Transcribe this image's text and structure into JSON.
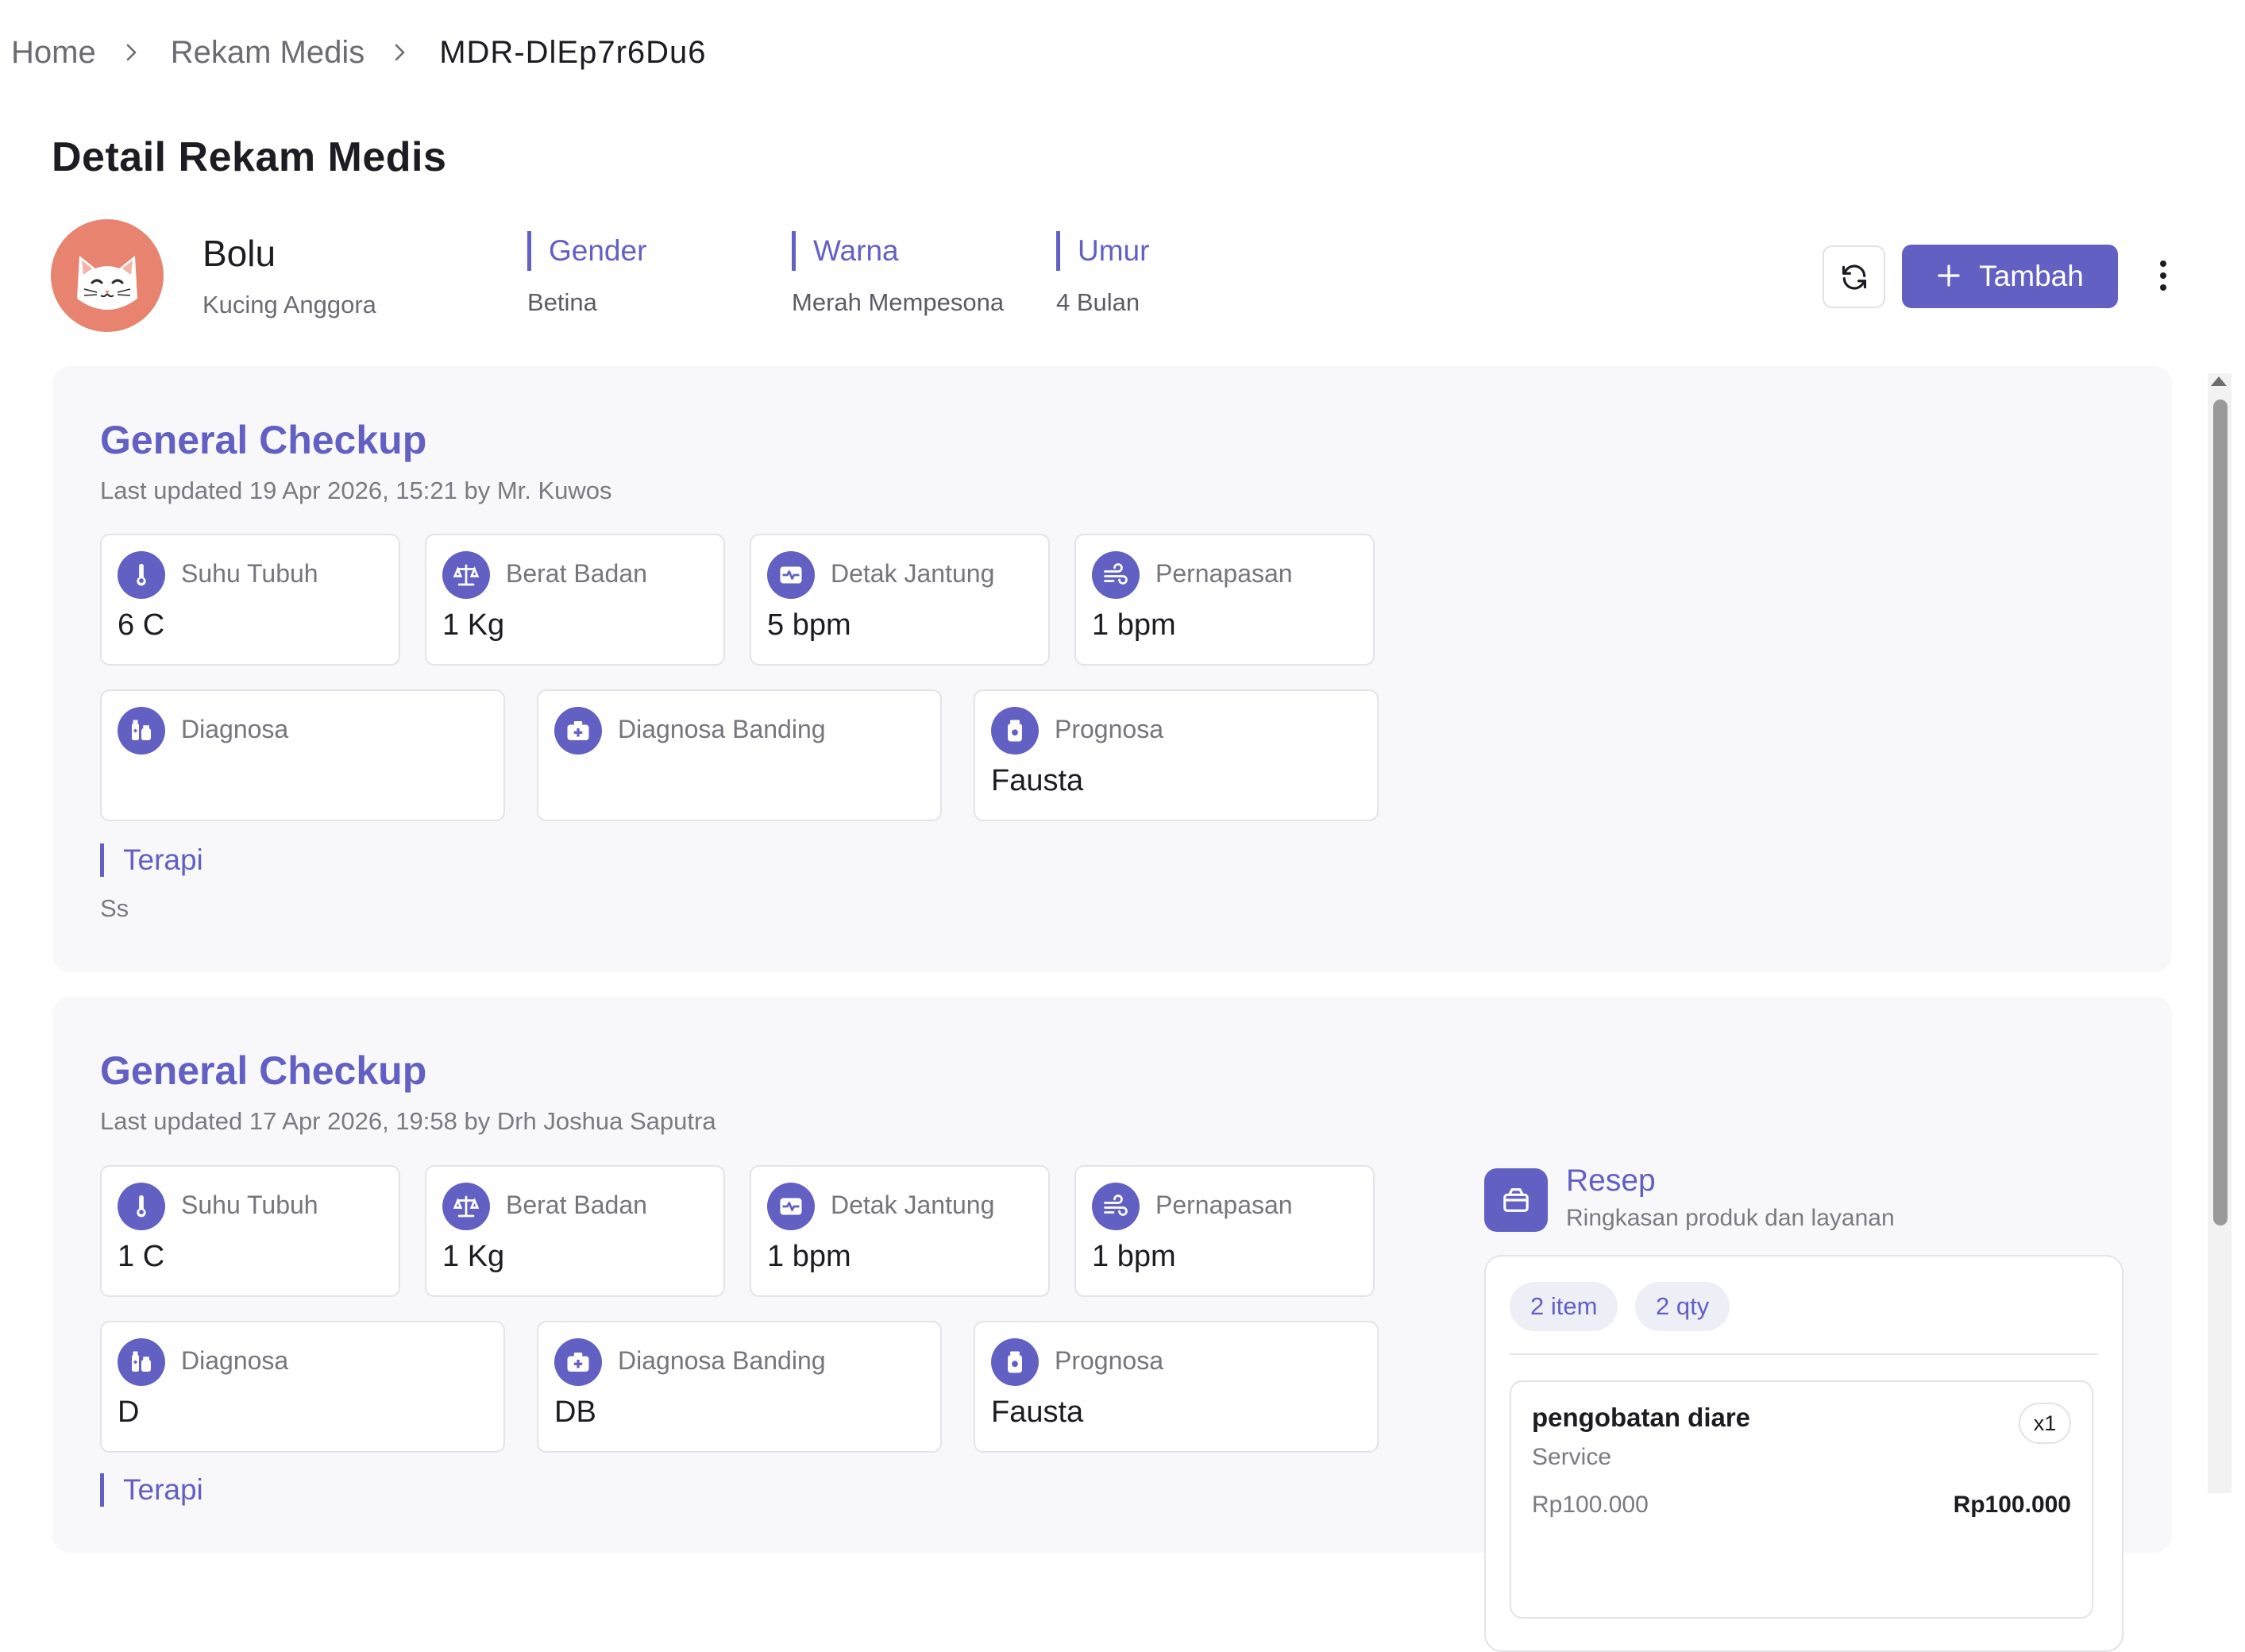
{
  "breadcrumb": {
    "home": "Home",
    "section": "Rekam Medis",
    "current": "MDR-DlEp7r6Du6"
  },
  "page_title": "Detail Rekam Medis",
  "pet": {
    "name": "Bolu",
    "breed": "Kucing Anggora",
    "gender_label": "Gender",
    "gender_value": "Betina",
    "color_label": "Warna",
    "color_value": "Merah Mempesona",
    "age_label": "Umur",
    "age_value": "4 Bulan"
  },
  "actions": {
    "add_label": "Tambah"
  },
  "records": [
    {
      "title": "General Checkup",
      "updated": "Last updated 19 Apr 2026, 15:21 by Mr. Kuwos",
      "vitals": {
        "temp_label": "Suhu Tubuh",
        "temp_value": "6 C",
        "weight_label": "Berat Badan",
        "weight_value": "1 Kg",
        "heart_label": "Detak Jantung",
        "heart_value": "5 bpm",
        "resp_label": "Pernapasan",
        "resp_value": "1 bpm"
      },
      "diag": {
        "diagnosa_label": "Diagnosa",
        "diagnosa_value": "",
        "banding_label": "Diagnosa Banding",
        "banding_value": "",
        "prognosa_label": "Prognosa",
        "prognosa_value": "Fausta"
      },
      "terapi_label": "Terapi",
      "terapi_value": "Ss"
    },
    {
      "title": "General Checkup",
      "updated": "Last updated 17 Apr 2026, 19:58 by Drh Joshua Saputra",
      "vitals": {
        "temp_label": "Suhu Tubuh",
        "temp_value": "1 C",
        "weight_label": "Berat Badan",
        "weight_value": "1 Kg",
        "heart_label": "Detak Jantung",
        "heart_value": "1 bpm",
        "resp_label": "Pernapasan",
        "resp_value": "1 bpm"
      },
      "diag": {
        "diagnosa_label": "Diagnosa",
        "diagnosa_value": "D",
        "banding_label": "Diagnosa Banding",
        "banding_value": "DB",
        "prognosa_label": "Prognosa",
        "prognosa_value": "Fausta"
      },
      "terapi_label": "Terapi",
      "resep": {
        "title": "Resep",
        "subtitle": "Ringkasan produk dan layanan",
        "item_count": "2 item",
        "qty_count": "2 qty",
        "items": [
          {
            "name": "pengobatan diare",
            "type": "Service",
            "qty": "x1",
            "unit_price": "Rp100.000",
            "total": "Rp100.000"
          }
        ]
      }
    }
  ],
  "colors": {
    "accent": "#6360c4",
    "card_bg": "#f8f8fa",
    "avatar_bg": "#e8836f"
  },
  "icons": [
    "chevron-right-icon",
    "refresh-icon",
    "plus-icon",
    "more-vertical-icon",
    "thermometer-icon",
    "scale-icon",
    "heart-monitor-icon",
    "wind-icon",
    "medicine-icon",
    "medical-kit-icon",
    "prognosis-icon",
    "bag-icon",
    "cat-avatar"
  ]
}
